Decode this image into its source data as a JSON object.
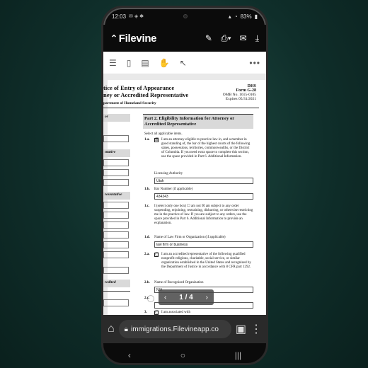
{
  "status": {
    "time": "12:03",
    "battery": "83%"
  },
  "app": {
    "name": "Filevine"
  },
  "pdf": {
    "title_line1": "tice of Entry of Appearance",
    "title_line2": "ney or Accredited Representative",
    "title_line3": "partment of Homeland Security",
    "dhs": "DHS",
    "form": "Form G-28",
    "omb": "OMB No. 1615-0105",
    "expires": "Expires 05/31/2021",
    "left_labels": {
      "l1": "or",
      "l2": "ntative",
      "l3": "resentative",
      "l4": "redited"
    },
    "part2": "Part 2.  Eligibility Information for Attorney or Accredited Representative",
    "select": "Select all applicable items.",
    "item_1a_num": "1.a.",
    "item_1a_check": "☒",
    "item_1a_text": "I am an attorney eligible to practice law in, and a member in good standing of, the bar of the highest courts of the following states, possessions, territories, commonwealths, or the District of Columbia.  If you need extra space to complete this section, use the space provided in Part 6. Additional Information.",
    "licensing_label": "Licensing Authority",
    "licensing_value": "Utah",
    "item_1b_num": "1.b.",
    "bar_label": "Bar Number (if applicable)",
    "bar_value": "434343",
    "item_1c_num": "1.c.",
    "item_1c_text": "I (select only one box)  ☐ am not  ☒ am subject to any order suspending, enjoining, restraining, disbarring, or otherwise restricting me in the practice of law.  If you are subject to any orders, use the space provided in Part 6. Additional Information to provide an explanation.",
    "item_1d_num": "1.d.",
    "firm_label": "Name of Law Firm or Organization (if applicable)",
    "firm_value": "law firm or business",
    "item_2a_num": "2.a.",
    "item_2a_check": "☐",
    "item_2a_text": "I am an accredited representative of the following qualified nonprofit religious, charitable, social service, or similar organization established in the United States and recognized by the Department of Justice in accordance with 8 CFR part 1292.",
    "item_2b_num": "2.b.",
    "org_label": "Name of Recognized Organization",
    "org_value": "N/A",
    "item_2c_num": "2.c.",
    "item_3_num": "3.",
    "item_3_check": "☐",
    "item_3_text": "I am associated with"
  },
  "pager": {
    "page": "1 / 4"
  },
  "browser": {
    "url": "immigrations.Filevineapp.co"
  }
}
